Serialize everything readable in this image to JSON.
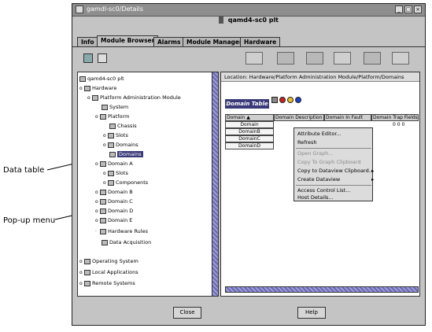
{
  "window": {
    "title": "gamdl-sc0/Details",
    "host_title": "qamd4-sc0 plt",
    "controls": [
      "_",
      "□",
      "×"
    ]
  },
  "tabs": [
    "Info",
    "Module Browser",
    "Alarms",
    "Module Manager",
    "Hardware"
  ],
  "active_tab": "Module Browser",
  "toolbar_icons": [
    "print-icon",
    "delete-icon",
    "disabled-icon",
    "edit-icon",
    "monitor-icon",
    "settings-icon"
  ],
  "tree": {
    "items": [
      {
        "label": "qamd4-sc0 plt"
      },
      {
        "label": "Hardware"
      },
      {
        "label": "Platform Administration Module"
      },
      {
        "label": "System"
      },
      {
        "label": "Platform"
      },
      {
        "label": "Chassis"
      },
      {
        "label": "Slots"
      },
      {
        "label": "Domains"
      },
      {
        "label": "Domains"
      },
      {
        "label": "Domain A"
      },
      {
        "label": "Slots"
      },
      {
        "label": "Components"
      },
      {
        "label": "Domain B"
      },
      {
        "label": "Domain C"
      },
      {
        "label": "Domain D"
      },
      {
        "label": "Domain E"
      },
      {
        "label": "Hardware Rules"
      },
      {
        "label": "Data Acquisition"
      },
      {
        "label": "Operating System"
      },
      {
        "label": "Local Applications"
      },
      {
        "label": "Remote Systems"
      }
    ]
  },
  "content": {
    "location_label": "Location:",
    "location_path": "Hardware/Platform Administration Module/Platform/Domains",
    "table_title": "Domain Table",
    "columns": [
      "Domain ▲",
      "Domain Description",
      "Domain In Fault",
      "Domain Trap Fields"
    ],
    "rows": [
      "Domain",
      "DomainB",
      "DomainC",
      "DomainD"
    ],
    "extra_cell": "0 0 0"
  },
  "popup": {
    "items": [
      {
        "label": "Attribute Editor...",
        "enabled": true,
        "submenu": false
      },
      {
        "label": "Refresh",
        "enabled": true,
        "submenu": false
      },
      {
        "label": "Open Graph...",
        "enabled": false,
        "submenu": false
      },
      {
        "label": "Copy To Graph Clipboard",
        "enabled": false,
        "submenu": false
      },
      {
        "label": "Copy to Dataview Clipboard...",
        "enabled": true,
        "submenu": true
      },
      {
        "label": "Create Dataview",
        "enabled": true,
        "submenu": true
      },
      {
        "label": "Access Control List...",
        "enabled": true,
        "submenu": false
      },
      {
        "label": "Host Details...",
        "enabled": true,
        "submenu": false
      }
    ]
  },
  "buttons": {
    "close": "Close",
    "help": "Help"
  },
  "callouts": {
    "data_table": "Data table",
    "popup_menu": "Pop-up menu"
  }
}
